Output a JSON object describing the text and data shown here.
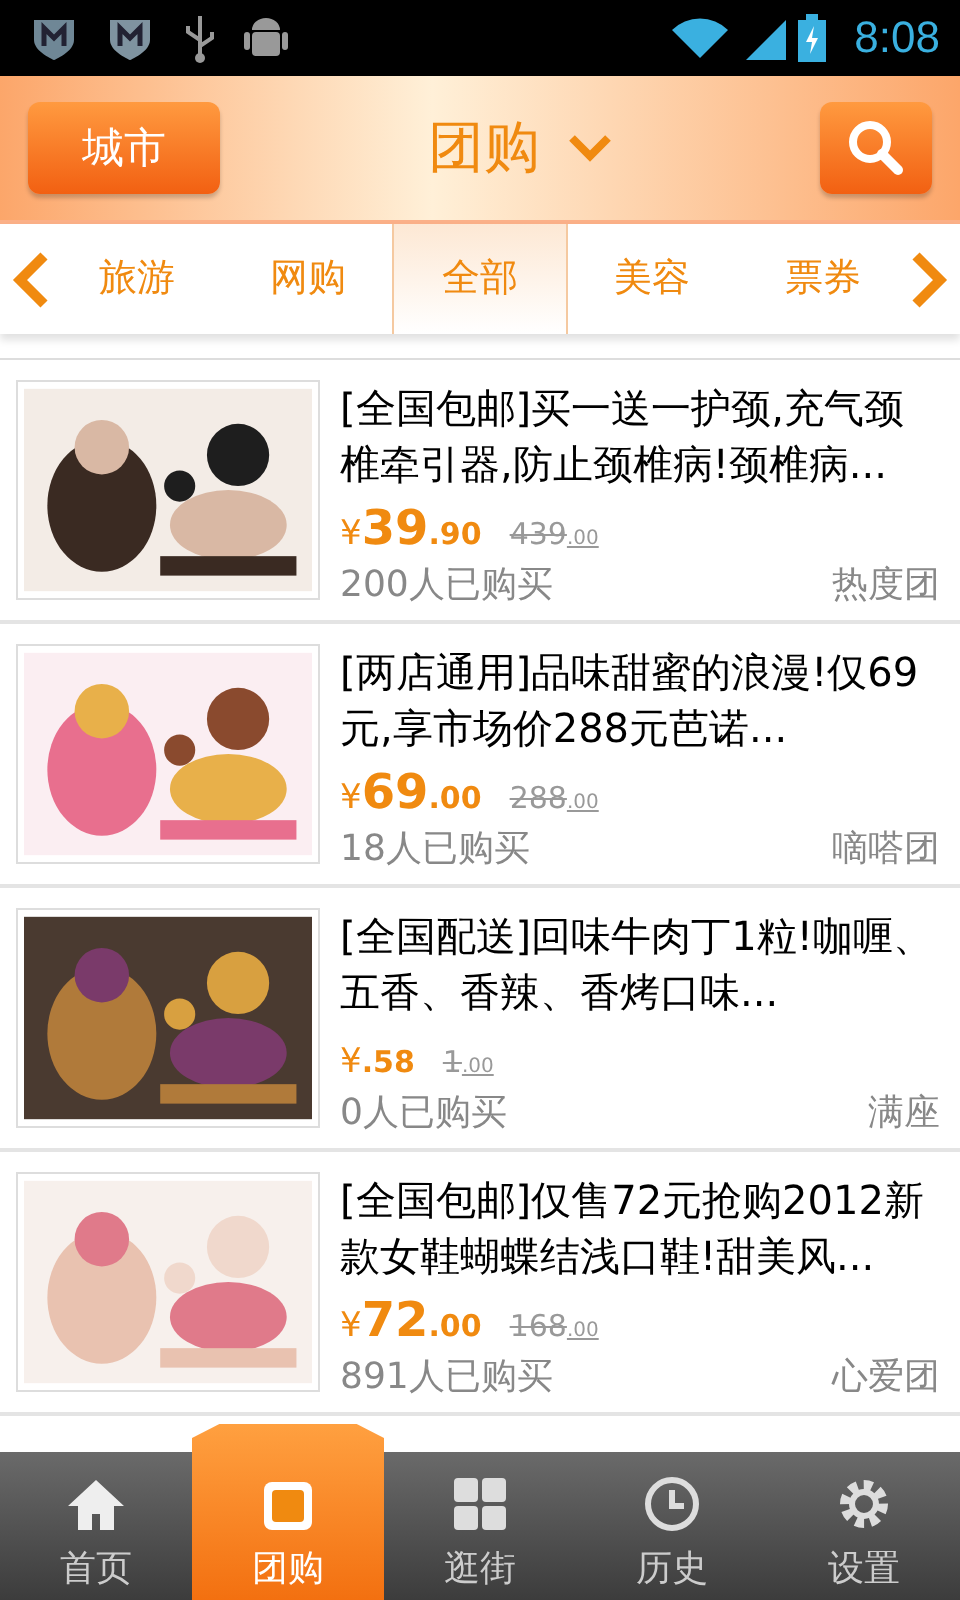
{
  "status_bar": {
    "time": "8:08"
  },
  "header": {
    "city_button": "城市",
    "title": "团购"
  },
  "categories": [
    {
      "label": "旅游",
      "selected": false
    },
    {
      "label": "网购",
      "selected": false
    },
    {
      "label": "全部",
      "selected": true
    },
    {
      "label": "美容",
      "selected": false
    },
    {
      "label": "票券",
      "selected": false
    }
  ],
  "deals": [
    {
      "title": "[全国包邮]买一送一护颈,充气颈椎牵引器,防止颈椎病!颈椎病...",
      "currency": "¥",
      "price_int": "39",
      "price_dec": ".90",
      "original_int": "439",
      "original_dec": ".00",
      "sold": "200人已购买",
      "source": "热度团"
    },
    {
      "title": "[两店通用]品味甜蜜的浪漫!仅69元,享市场价288元芭诺...",
      "currency": "¥",
      "price_int": "69",
      "price_dec": ".00",
      "original_int": "288",
      "original_dec": ".00",
      "sold": "18人已购买",
      "source": "嘀嗒团"
    },
    {
      "title": "[全国配送]回味牛肉丁1粒!咖喱、五香、香辣、香烤口味...",
      "currency": "¥",
      "price_dec": ".58",
      "original_int": "1",
      "original_dec": ".00",
      "sold": "0人已购买",
      "source": "满座"
    },
    {
      "title": "[全国包邮]仅售72元抢购2012新款女鞋蝴蝶结浅口鞋!甜美风...",
      "currency": "¥",
      "price_int": "72",
      "price_dec": ".00",
      "original_int": "168",
      "original_dec": ".00",
      "sold": "891人已购买",
      "source": "心爱团"
    }
  ],
  "bottom_nav": [
    {
      "label": "首页",
      "selected": false
    },
    {
      "label": "团购",
      "selected": true
    },
    {
      "label": "逛街",
      "selected": false
    },
    {
      "label": "历史",
      "selected": false
    },
    {
      "label": "设置",
      "selected": false
    }
  ]
}
